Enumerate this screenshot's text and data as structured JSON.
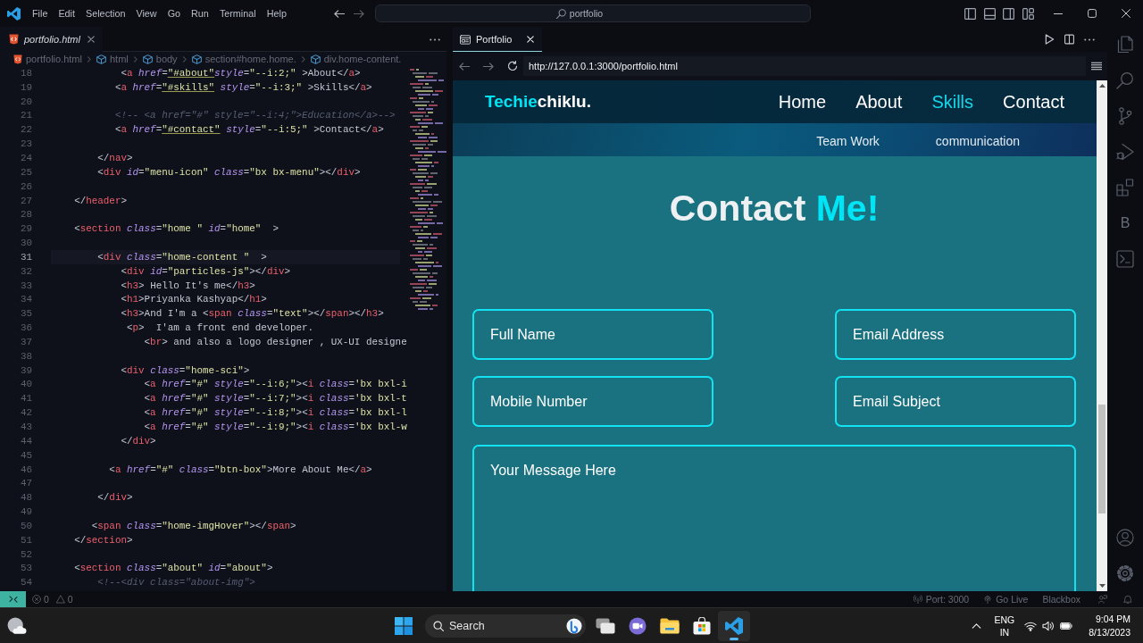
{
  "title_bar": {
    "menu": [
      "File",
      "Edit",
      "Selection",
      "View",
      "Go",
      "Run",
      "Terminal",
      "Help"
    ],
    "command_center": {
      "label": "portfolio"
    }
  },
  "editor": {
    "tab": {
      "label": "portfolio.html",
      "selected": true
    },
    "breadcrumbs": [
      "portfolio.html",
      "html",
      "body",
      "section#home.home.",
      "div.home-content."
    ],
    "lines": [
      {
        "number": "18",
        "text": "            <a href=\"#about\"style=\"--i:2;\" >About</a>",
        "current": false
      },
      {
        "number": "19",
        "text": "           <a href=\"#skills\" style=\"--i:3;\" >Skills</a>",
        "current": false
      },
      {
        "number": "20",
        "current": false
      },
      {
        "number": "21",
        "text": "           <!-- <a href=\"#\" style=\"--i:4;\">Education</a>-->",
        "current": false
      },
      {
        "number": "22",
        "text": "           <a href=\"#contact\" style=\"--i:5;\" >Contact</a>",
        "current": false
      },
      {
        "number": "23",
        "current": false
      },
      {
        "number": "24",
        "text": "        </nav>",
        "current": false
      },
      {
        "number": "25",
        "text": "        <div id=\"menu-icon\" class=\"bx bx-menu\"></div>",
        "current": false
      },
      {
        "number": "26",
        "current": false
      },
      {
        "number": "27",
        "text": "    </header>",
        "current": false
      },
      {
        "number": "28",
        "current": false
      },
      {
        "number": "29",
        "text": "    <section class=\"home \" id=\"home\"  >",
        "current": false
      },
      {
        "number": "30",
        "current": false
      },
      {
        "number": "31",
        "text": "        <div class=\"home-content \"  >",
        "current": true
      },
      {
        "number": "32",
        "text": "            <div id=\"particles-js\"></div>",
        "current": false
      },
      {
        "number": "33",
        "text": "            <h3> Hello It's me</h3>",
        "current": false
      },
      {
        "number": "34",
        "text": "            <h1>Priyanka Kashyap</h1>",
        "current": false
      },
      {
        "number": "35",
        "text": "            <h3>And I'm a <span class=\"text\"></span></h3>",
        "current": false
      },
      {
        "number": "36",
        "text": "             <p>  I'am a front end developer.",
        "current": false
      },
      {
        "number": "37",
        "text": "                <br> and also a logo designer , UX-UI designe",
        "current": false
      },
      {
        "number": "38",
        "current": false
      },
      {
        "number": "39",
        "text": "            <div class=\"home-sci\">",
        "current": false
      },
      {
        "number": "40",
        "text": "                <a href=\"#\" style=\"--i:6;\"><i class='bx bxl-i",
        "current": false
      },
      {
        "number": "41",
        "text": "                <a href=\"#\" style=\"--i:7;\"><i class='bx bxl-t",
        "current": false
      },
      {
        "number": "42",
        "text": "                <a href=\"#\" style=\"--i:8;\"><i class='bx bxl-l",
        "current": false
      },
      {
        "number": "43",
        "text": "                <a href=\"#\" style=\"--i:9;\"><i class='bx bxl-w",
        "current": false
      },
      {
        "number": "44",
        "text": "            </div>",
        "current": false
      },
      {
        "number": "45",
        "current": false
      },
      {
        "number": "46",
        "text": "          <a href=\"#\" class=\"btn-box\">More About Me</a>",
        "current": false
      },
      {
        "number": "47",
        "current": false
      },
      {
        "number": "48",
        "text": "        </div>",
        "current": false
      },
      {
        "number": "49",
        "current": false
      },
      {
        "number": "50",
        "text": "       <span class=\"home-imgHover\"></span>",
        "current": false
      },
      {
        "number": "51",
        "text": "    </section>",
        "current": false
      },
      {
        "number": "52",
        "current": false
      },
      {
        "number": "53",
        "text": "    <section class=\"about\" id=\"about\">",
        "current": false
      },
      {
        "number": "54",
        "text": "        <!--<div class=\"about-img\">",
        "current": false
      }
    ]
  },
  "browser": {
    "tab": {
      "label": "Portfolio",
      "selected": true
    },
    "url": "http://127.0.0.1:3000/portfolio.html",
    "site": {
      "logo": {
        "accent": "Techie",
        "rest": "chiklu."
      },
      "nav": [
        {
          "label": "Home",
          "selected": false
        },
        {
          "label": "About",
          "selected": false
        },
        {
          "label": "Skills",
          "selected": true
        },
        {
          "label": "Contact",
          "selected": false
        }
      ],
      "skills": [
        "Team Work",
        "communication"
      ],
      "heading": {
        "text": "Contact",
        "accent": "Me!"
      },
      "fields": [
        {
          "placeholder": "Full Name"
        },
        {
          "placeholder": "Email Address"
        },
        {
          "placeholder": "Mobile Number"
        },
        {
          "placeholder": "Email Subject"
        }
      ],
      "message": {
        "placeholder": "Your Message Here"
      }
    }
  },
  "activity_bar": {
    "letter_item": "B"
  },
  "status_bar": {
    "errors": "0",
    "warnings": "0",
    "port": "Port: 3000",
    "live": "Go Live",
    "extension": "Blackbox"
  },
  "taskbar": {
    "search": {
      "placeholder": "Search"
    },
    "apps": [
      {
        "active": false
      },
      {
        "active": false
      },
      {
        "active": false
      },
      {
        "active": false
      },
      {
        "active": true
      }
    ],
    "language": "ENG",
    "region": "IN",
    "time": "9:04 PM",
    "date": "8/13/2023"
  }
}
